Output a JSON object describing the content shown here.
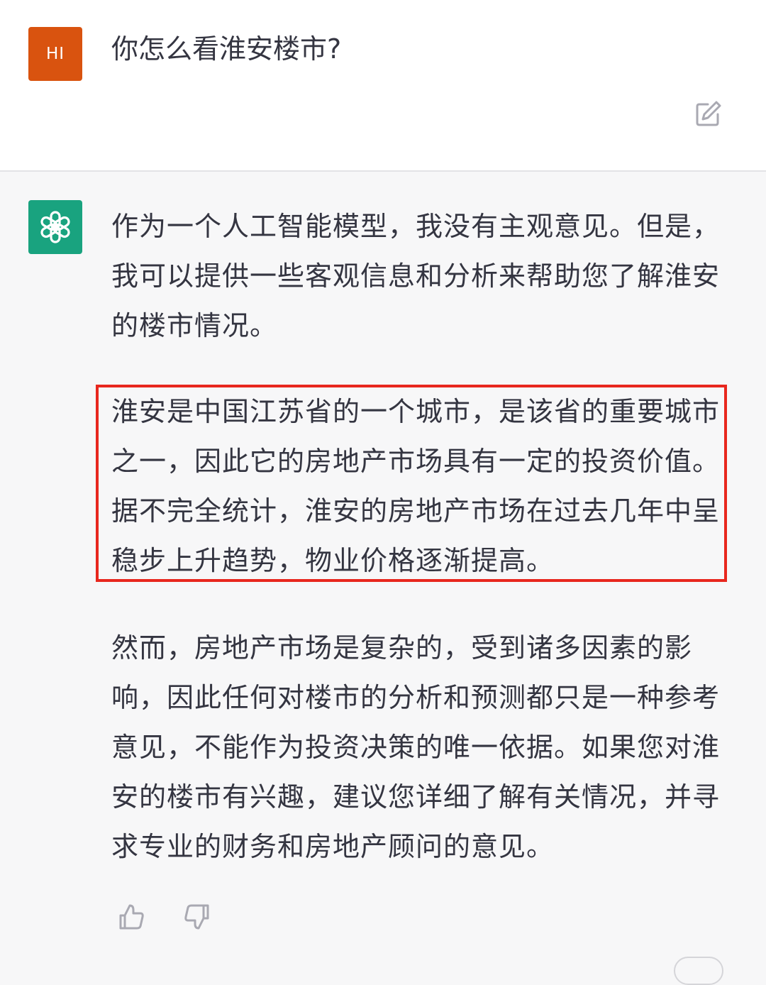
{
  "user": {
    "avatar_label": "HI",
    "avatar_color": "#d9530f",
    "question": "你怎么看淮安楼市?"
  },
  "actions": {
    "edit_icon": "edit-icon",
    "thumbs_up_icon": "thumbs-up-icon",
    "thumbs_down_icon": "thumbs-down-icon"
  },
  "assistant": {
    "avatar_icon": "openai-logo-icon",
    "avatar_color": "#19a37f",
    "paragraphs": [
      "作为一个人工智能模型，我没有主观意见。但是，我可以提供一些客观信息和分析来帮助您了解淮安的楼市情况。",
      "淮安是中国江苏省的一个城市，是该省的重要城市之一，因此它的房地产市场具有一定的投资价值。据不完全统计，淮安的房地产市场在过去几年中呈稳步上升趋势，物业价格逐渐提高。",
      "然而，房地产市场是复杂的，受到诸多因素的影响，因此任何对楼市的分析和预测都只是一种参考意见，不能作为投资决策的唯一依据。如果您对淮安的楼市有兴趣，建议您详细了解有关情况，并寻求专业的财务和房地产顾问的意见。"
    ],
    "highlight_color": "#e8271e"
  }
}
